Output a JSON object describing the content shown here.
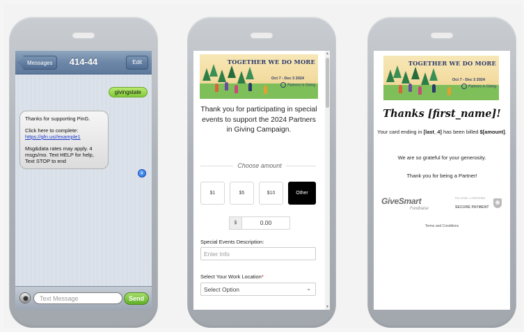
{
  "phone1": {
    "nav": {
      "back_label": "Messages",
      "title": "414-44",
      "edit_label": "Edit"
    },
    "outgoing": "givingstate",
    "incoming": {
      "line1": "Thanks for supporting PinG.",
      "line2": "Click here to complete:",
      "link": "https://gfn.us//example1",
      "line3": "Msg&data rates may apply. 4 msgs/mo. Text HELP for help, Text STOP to end"
    },
    "compose": {
      "placeholder": "Text Message",
      "send_label": "Send"
    }
  },
  "phone2": {
    "banner": {
      "headline": "TOGETHER WE DO MORE",
      "dates": "Oct 7 - Dec 3 2024",
      "logo_text": "Partners in Giving"
    },
    "intro": "Thank you for participating in special events to support the 2024 Partners in Giving Campaign.",
    "choose_label": "Choose amount",
    "amounts": [
      "$1",
      "$5",
      "$10",
      "Other"
    ],
    "selected_amount": "Other",
    "currency": "$",
    "amount_value": "0.00",
    "description_label": "Special Events Description:",
    "description_placeholder": "Enter Info",
    "location_label": "Select Your Work Location",
    "location_required": "*",
    "location_value": "Select Option"
  },
  "phone3": {
    "banner": {
      "headline": "TOGETHER WE DO MORE",
      "dates": "Oct 7 - Dec 3 2024",
      "logo_text": "Partners in Giving"
    },
    "title": "Thanks [first_name]!",
    "card_prefix": "Your card ending in ",
    "card_token": "[last_4]",
    "card_mid": " has been billed ",
    "amount_token": "$[amount]",
    "card_suffix": ".",
    "grateful": "We are so grateful for your generosity.",
    "partner": "Thank you for being a Partner!",
    "brand": "GiveSmart",
    "brand_sub": "Fundraise",
    "pci_text": "PCI LEVEL 1 CERTIFIED",
    "secure_text": "SECURE PAYMENT",
    "terms": "Terms and Conditions"
  }
}
